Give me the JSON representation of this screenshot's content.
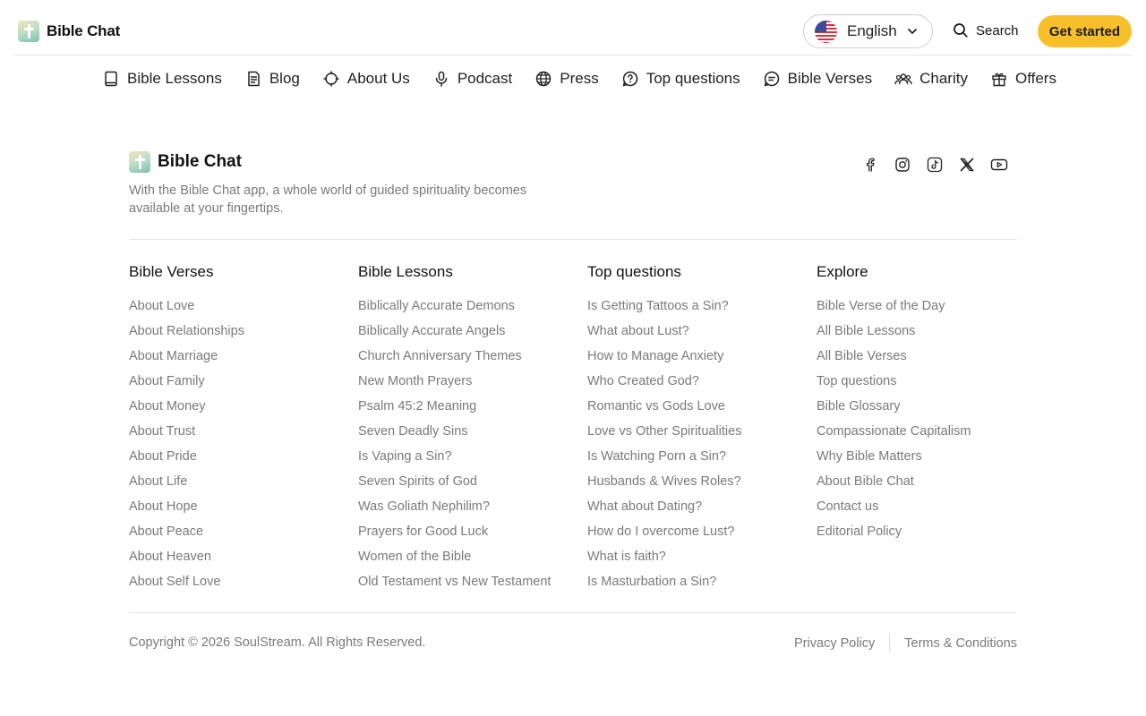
{
  "header": {
    "brand": "Bible Chat",
    "language": "English",
    "search_label": "Search",
    "cta_label": "Get started"
  },
  "nav": [
    {
      "label": "Bible Lessons",
      "icon": "book-icon"
    },
    {
      "label": "Blog",
      "icon": "document-icon"
    },
    {
      "label": "About Us",
      "icon": "crosshair-icon"
    },
    {
      "label": "Podcast",
      "icon": "microphone-icon"
    },
    {
      "label": "Press",
      "icon": "globe-icon"
    },
    {
      "label": "Top questions",
      "icon": "question-icon"
    },
    {
      "label": "Bible Verses",
      "icon": "chat-bubble-icon"
    },
    {
      "label": "Charity",
      "icon": "people-icon"
    },
    {
      "label": "Offers",
      "icon": "gift-icon"
    }
  ],
  "footer": {
    "brand": "Bible Chat",
    "tagline": "With the Bible Chat app, a whole world of guided spirituality becomes available at your fingertips.",
    "social": [
      "facebook-icon",
      "instagram-icon",
      "tiktok-icon",
      "x-icon",
      "youtube-icon"
    ],
    "columns": [
      {
        "title": "Bible Verses",
        "links": [
          "About Love",
          "About Relationships",
          "About Marriage",
          "About Family",
          "About Money",
          "About Trust",
          "About Pride",
          "About Life",
          "About Hope",
          "About Peace",
          "About Heaven",
          "About Self Love"
        ]
      },
      {
        "title": "Bible Lessons",
        "links": [
          "Biblically Accurate Demons",
          "Biblically Accurate Angels",
          "Church Anniversary Themes",
          "New Month Prayers",
          "Psalm 45:2 Meaning",
          "Seven Deadly Sins",
          "Is Vaping a Sin?",
          "Seven Spirits of God",
          "Was Goliath Nephilim?",
          "Prayers for Good Luck",
          "Women of the Bible",
          "Old Testament vs New Testament"
        ]
      },
      {
        "title": "Top questions",
        "links": [
          "Is Getting Tattoos a Sin?",
          "What about Lust?",
          "How to Manage Anxiety",
          "Who Created God?",
          "Romantic vs Gods Love",
          "Love vs Other Spiritualities",
          "Is Watching Porn a Sin?",
          "Husbands & Wives Roles?",
          "What about Dating?",
          "How do I overcome Lust?",
          "What is faith?",
          "Is Masturbation a Sin?"
        ]
      },
      {
        "title": "Explore",
        "links": [
          "Bible Verse of the Day",
          "All Bible Lessons",
          "All Bible Verses",
          "Top questions",
          "Bible Glossary",
          "Compassionate Capitalism",
          "Why Bible Matters",
          "About Bible Chat",
          "Contact us",
          "Editorial Policy"
        ]
      }
    ],
    "copyright": "Copyright © 2026 SoulStream. All Rights Reserved.",
    "privacy": "Privacy Policy",
    "terms": "Terms & Conditions"
  },
  "colors": {
    "accent": "#f7c02b",
    "muted_text": "#7a7a7a",
    "divider": "#e6e6e6"
  }
}
